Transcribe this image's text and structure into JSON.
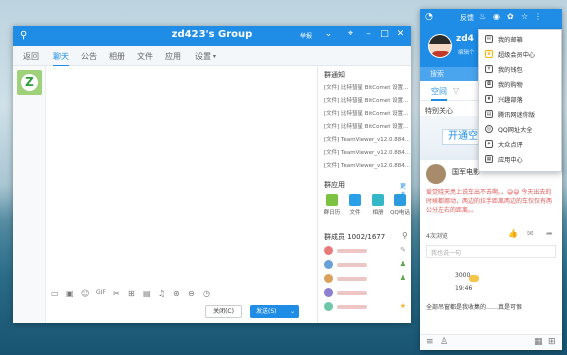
{
  "group_window": {
    "title": "zd423's Group",
    "report": "举报",
    "tabs": [
      "返回",
      "聊天",
      "公告",
      "相册",
      "文件",
      "应用",
      "设置"
    ],
    "notice_title": "群通知",
    "notices": [
      "[文件] 比特彗星 BitComet 设置...",
      "[文件] 比特彗星 BitComet 设置...",
      "[文件] 比特彗星 BitComet 设置...",
      "[文件] 比特彗星 BitComet 设置...",
      "[文件] TeamViewer_v12.0.884...",
      "[文件] TeamViewer_v12.0.884...",
      "[文件] TeamViewer_v12.0.884..."
    ],
    "apps_title": "群应用",
    "apps_more": "更多",
    "apps": [
      {
        "label": "群日历",
        "color": "#7ec242"
      },
      {
        "label": "文件",
        "color": "#2aa0e6"
      },
      {
        "label": "相册",
        "color": "#33b7c9"
      },
      {
        "label": "QQ电话",
        "color": "#2d9be0"
      }
    ],
    "members_title": "群成员 1002/1677",
    "close_label": "关闭(C)",
    "send_label": "发送(S)",
    "send_arrow": "⌄"
  },
  "qq_panel": {
    "feedback": "反馈",
    "username": "zd4",
    "edit": "编辑个",
    "search": "搜索",
    "space_tab": "空间",
    "special": "特别关心",
    "open_banner": "开通空",
    "feed_author": "国军电影",
    "feed_text": "爱觉晓天亮上说车出不去啊。。😅😅 今天出去的时候都挪动，两边的拉手距离两边的车仅仅有两公分左右的距离。。",
    "feed_count": "4次浏览",
    "comment_placeholder": "我也说一句",
    "line2_user": "3000",
    "line2_time": "19:46",
    "line3": "全部吊窗都是我收集的……真是可恨"
  },
  "dropdown": {
    "items": [
      "我的邮箱",
      "超级会员中心",
      "我的钱包",
      "我的购物",
      "兴趣部落",
      "腾讯网迷你版",
      "QQ网址大全",
      "大众点评",
      "应用中心"
    ]
  }
}
